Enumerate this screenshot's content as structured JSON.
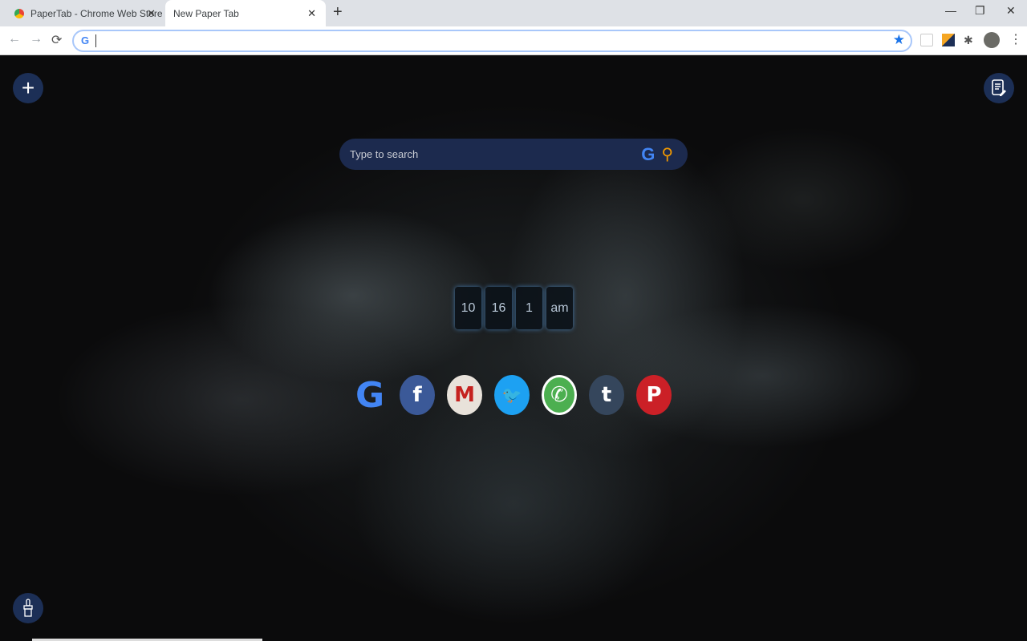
{
  "browser": {
    "tabs": [
      {
        "title": "PaperTab - Chrome Web Store",
        "active": false
      },
      {
        "title": "New Paper Tab",
        "active": true
      }
    ],
    "close_glyph": "✕",
    "new_tab_glyph": "+",
    "window_controls": [
      "—",
      "❐",
      "✕"
    ],
    "address_value": "",
    "nav": {
      "back": "←",
      "forward": "→",
      "reload": "⟳"
    },
    "extensions": [
      "bookmark-star-icon",
      "extension-box-icon",
      "papertab-extension-icon",
      "puzzle-icon",
      "profile-avatar",
      "menu-dots-icon"
    ]
  },
  "page": {
    "add_button_glyph": "+",
    "search": {
      "placeholder": "Type to search",
      "engine_icon": "google-g-icon",
      "button_icon": "search-icon",
      "accent": "#f29900"
    },
    "clock": {
      "hour": "10",
      "minute": "16",
      "second": "1",
      "period": "am"
    },
    "shortcuts": [
      {
        "name": "Google",
        "glyph": "G",
        "color": "#ffffff"
      },
      {
        "name": "Facebook",
        "glyph": "f",
        "color": "#3b5998"
      },
      {
        "name": "Gmail",
        "glyph": "M",
        "color": "#e8e2da"
      },
      {
        "name": "Twitter",
        "glyph": "🐦",
        "color": "#1da1f2"
      },
      {
        "name": "WhatsApp",
        "glyph": "✆",
        "color": "#4caf50"
      },
      {
        "name": "Tumblr",
        "glyph": "t",
        "color": "#35465c"
      },
      {
        "name": "Pinterest",
        "glyph": "P",
        "color": "#cb2027"
      }
    ],
    "fab_color": "#1c2f56"
  }
}
